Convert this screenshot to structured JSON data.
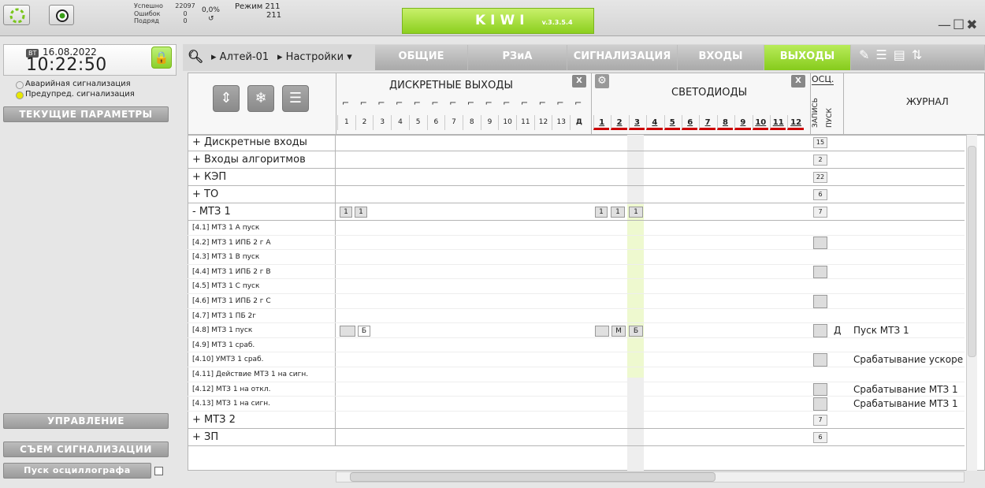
{
  "header": {
    "stat_labels": [
      "Успешно",
      "Ошибок",
      "Подряд"
    ],
    "stat_values": [
      "22097",
      "0",
      "0"
    ],
    "percent": "0,0%",
    "cycle_icon": "↺",
    "mode_label": "Режим",
    "mode_value": "211",
    "mode_value2": "211",
    "app_name": "KIWI",
    "version": "v.3.3.5.4",
    "window_controls": "—☐✖"
  },
  "left": {
    "day": "ВТ",
    "date": "16.08.2022",
    "time": "10:22:50",
    "alarms": [
      {
        "label": "Аварийная сигнализация",
        "color": "#e8e8e8"
      },
      {
        "label": "Предупред. сигнализация",
        "color": "#e8e800"
      }
    ],
    "current_params": "ТЕКУЩИЕ ПАРАМЕТРЫ",
    "control": "УПРАВЛЕНИЕ",
    "alarm_reset": "СЪЕМ СИГНАЛИЗАЦИИ",
    "osc_start": "Пуск осциллографа"
  },
  "nav": {
    "crumb_device": "Алтей-01",
    "crumb_settings": "Настройки",
    "tabs": [
      "ОБЩИЕ",
      "РЗиА",
      "СИГНАЛИЗАЦИЯ",
      "ВХОДЫ",
      "ВЫХОДЫ"
    ],
    "active_tab": "ВЫХОДЫ"
  },
  "grid": {
    "discrete_title": "ДИСКРЕТНЫЕ ВЫХОДЫ",
    "led_title": "СВЕТОДИОДЫ",
    "osc_title": "ОСЦ.",
    "rec_label": "ЗАПИСЬ",
    "pusk_label": "ПУСК",
    "journal_title": "ЖУРНАЛ",
    "close_x": "X",
    "discrete_cols": [
      "1",
      "2",
      "3",
      "4",
      "5",
      "6",
      "7",
      "8",
      "9",
      "10",
      "11",
      "12",
      "13",
      "Д"
    ],
    "led_cols": [
      "1",
      "2",
      "3",
      "4",
      "5",
      "6",
      "7",
      "8",
      "9",
      "10",
      "11",
      "12"
    ],
    "rows": [
      {
        "name": "+ Дискретные входы",
        "type": "grp",
        "osc": "15"
      },
      {
        "name": "+ Входы алгоритмов",
        "type": "grp",
        "osc": "2"
      },
      {
        "name": "+ КЭП",
        "type": "grp",
        "osc": "22"
      },
      {
        "name": "+ ТО",
        "type": "grp",
        "osc": "6"
      },
      {
        "name": "- МТЗ 1",
        "type": "grp",
        "osc": "7",
        "d1": "1",
        "d2": "1",
        "l1": "1",
        "l2": "1",
        "l3": "1"
      },
      {
        "name": "[4.1] МТЗ 1 А пуск",
        "type": "sub"
      },
      {
        "name": "[4.2] МТЗ 1 ИПБ 2 г А",
        "type": "sub",
        "box": true
      },
      {
        "name": "[4.3] МТЗ 1 В пуск",
        "type": "sub"
      },
      {
        "name": "[4.4] МТЗ 1 ИПБ 2 г В",
        "type": "sub",
        "box": true
      },
      {
        "name": "[4.5] МТЗ 1 С пуск",
        "type": "sub"
      },
      {
        "name": "[4.6] МТЗ 1 ИПБ 2 г С",
        "type": "sub",
        "box": true
      },
      {
        "name": "[4.7] МТЗ 1 ПБ 2г",
        "type": "sub"
      },
      {
        "name": "[4.8] МТЗ 1 пуск",
        "type": "sub",
        "box": true,
        "d2": "Б",
        "l2": "М",
        "l3": "Б",
        "dm": "Д",
        "journal": "Пуск МТЗ 1"
      },
      {
        "name": "[4.9] МТЗ 1 сраб.",
        "type": "sub"
      },
      {
        "name": "[4.10] УМТЗ 1 сраб.",
        "type": "sub",
        "box": true,
        "journal": "Срабатывание ускоре"
      },
      {
        "name": "[4.11] Действие МТЗ 1 на сигн.",
        "type": "sub"
      },
      {
        "name": "[4.12] МТЗ 1 на откл.",
        "type": "sub",
        "box": true,
        "journal": "Срабатывание МТЗ 1"
      },
      {
        "name": "[4.13] МТЗ 1 на сигн.",
        "type": "sub",
        "box": true,
        "journal": "Срабатывание МТЗ 1"
      },
      {
        "name": "+ МТЗ 2",
        "type": "grp",
        "osc": "7"
      },
      {
        "name": "+ ЗП",
        "type": "grp",
        "osc": "6"
      }
    ]
  }
}
